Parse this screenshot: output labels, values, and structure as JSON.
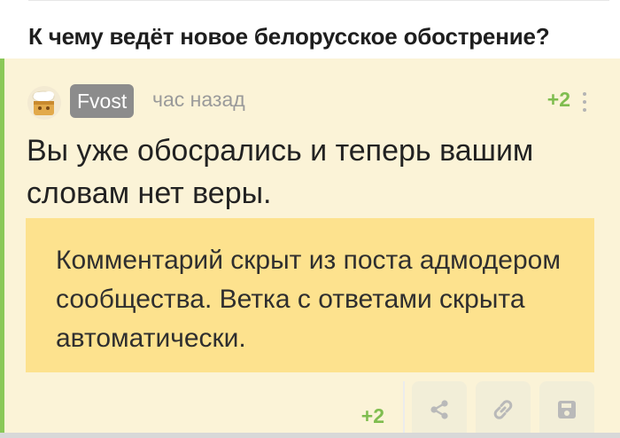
{
  "post": {
    "title": "К чему ведёт новое белорусское обострение?"
  },
  "comment": {
    "author": "Fvost",
    "time": "час назад",
    "rating": "+2",
    "text": "Вы уже обосрались и теперь вашим словам нет веры.",
    "hidden_notice": "Комментарий скрыт из поста адмодером сообщества. Ветка с ответами скрыта автоматически.",
    "footer_rating": "+2",
    "actions": [
      "share-icon",
      "link-icon",
      "save-icon"
    ]
  },
  "colors": {
    "accent_green": "#7fbd4f",
    "comment_bg": "#fbf3d7",
    "notice_bg": "#fde28e",
    "badge_bg": "#8c8c8c"
  }
}
